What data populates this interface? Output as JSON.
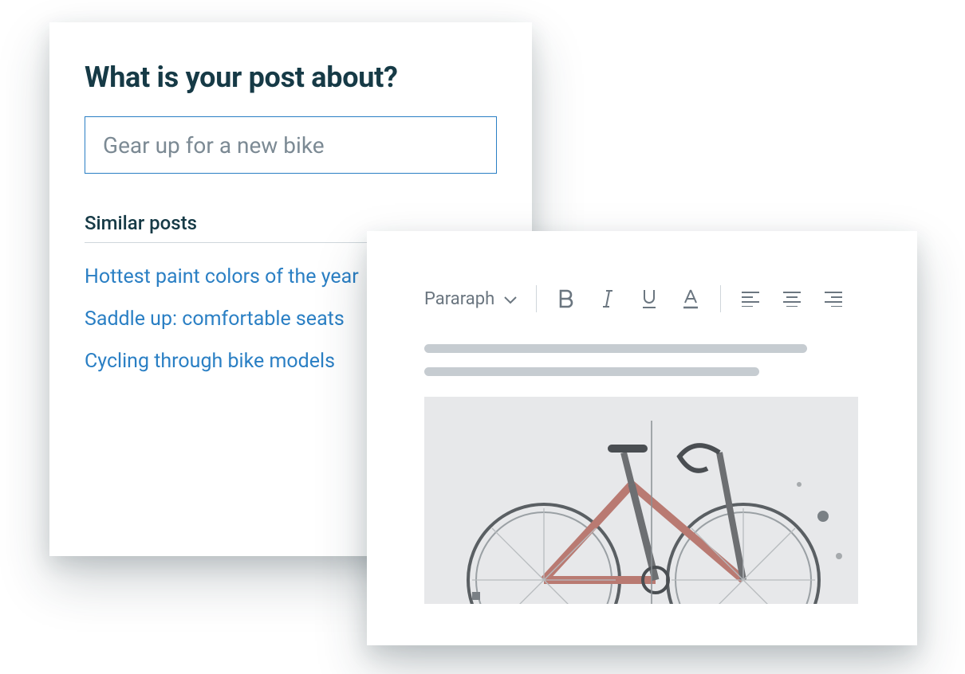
{
  "post_form": {
    "heading": "What is your post about?",
    "topic_value": "Gear up for a new bike",
    "similar_label": "Similar posts",
    "similar_posts": [
      "Hottest paint colors of the year",
      "Saddle up: comfortable seats",
      "Cycling through bike models"
    ]
  },
  "editor": {
    "style_selector": "Pararaph",
    "image_alt": "bicycle"
  }
}
